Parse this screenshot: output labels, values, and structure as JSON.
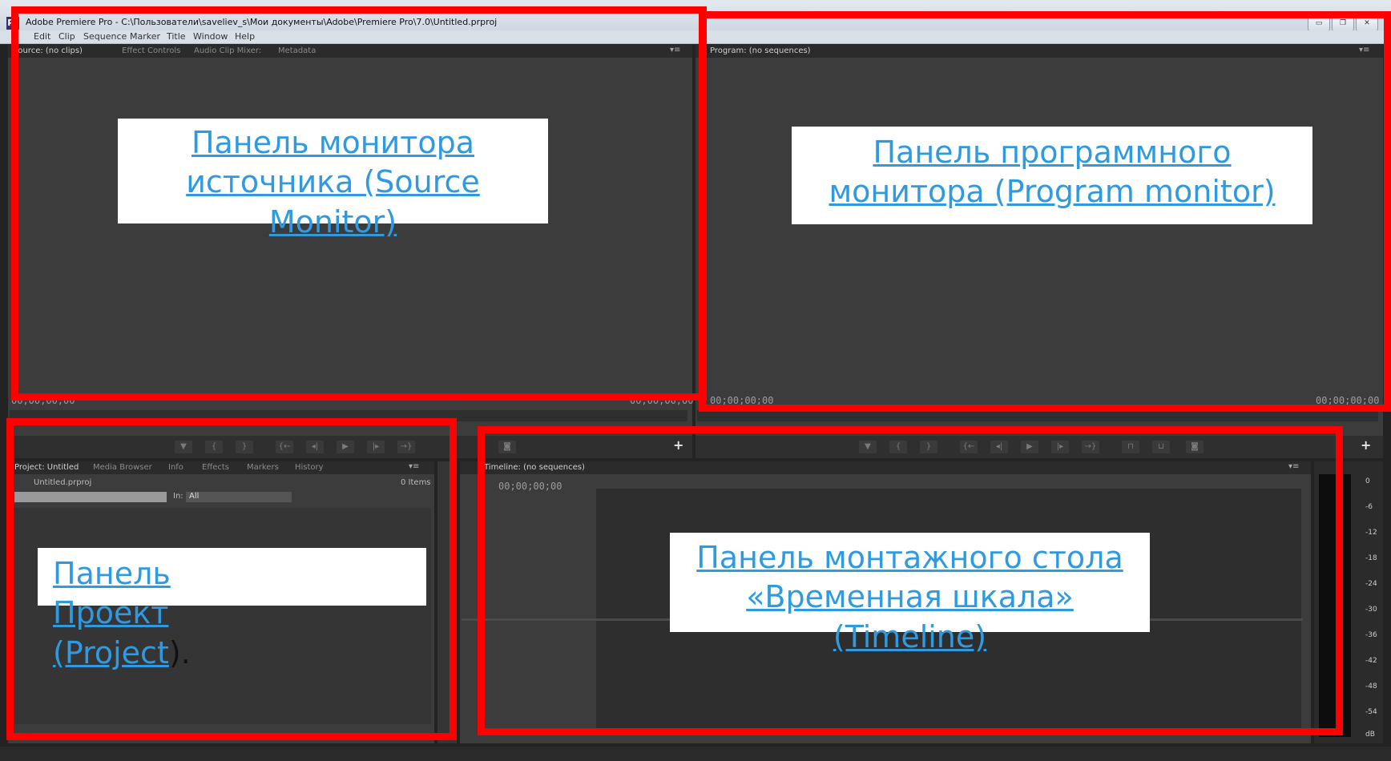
{
  "window": {
    "title": "Adobe Premiere Pro - C:\\Пользователи\\saveliev_s\\Мои документы\\Adobe\\Premiere Pro\\7.0\\Untitled.prproj",
    "icon": "Pr"
  },
  "menu": [
    "Edit",
    "Clip",
    "Sequence",
    "Marker",
    "Title",
    "Window",
    "Help"
  ],
  "source_panel": {
    "tabs": [
      "Source: (no clips)",
      "Effect Controls",
      "Audio Clip Mixer:",
      "Metadata"
    ],
    "timecode_left": "00;00;00;00",
    "timecode_right": "00;00;00;00"
  },
  "program_panel": {
    "tab": "Program: (no sequences)",
    "timecode_left": "00;00;00;00",
    "timecode_right": "00;00;00;00"
  },
  "project_panel": {
    "tabs": [
      "Project: Untitled",
      "Media Browser",
      "Info",
      "Effects",
      "Markers",
      "History"
    ],
    "file": "Untitled.prproj",
    "items_count": "0 Items",
    "in_label": "In:",
    "in_value": "All"
  },
  "timeline_panel": {
    "tab": "Timeline: (no sequences)",
    "timecode": "00;00;00;00"
  },
  "audio_meter": {
    "labels": [
      "0",
      "-6",
      "-12",
      "-18",
      "-24",
      "-30",
      "-36",
      "-42",
      "-48",
      "-54",
      "dB"
    ]
  },
  "annotations": {
    "source": "Панель монитора источника (Source Monitor)",
    "program": "Панель программного монитора (Program monitor)",
    "project_link": "Панель Проект (Project",
    "project_tail": ").",
    "timeline": "Панель монтажного стола «Временная шкала» (Timeline)"
  },
  "colors": {
    "annotation_red": "#ff0000",
    "link_blue": "#2f9ae0",
    "panel_bg": "#3c3c3c"
  }
}
